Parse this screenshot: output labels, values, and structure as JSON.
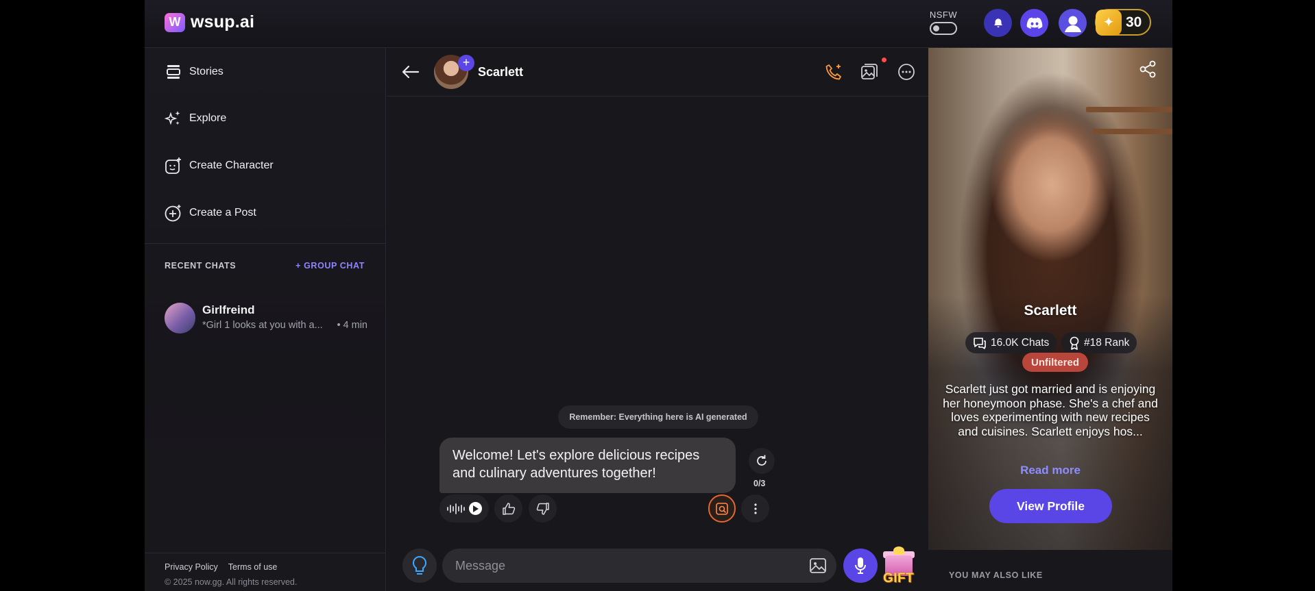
{
  "brand": {
    "logo_mark": "W",
    "name": "wsup.ai"
  },
  "topbar": {
    "nsfw_label": "NSFW",
    "nsfw_enabled": false,
    "coins": "30",
    "icons": [
      "bell-icon",
      "discord-icon",
      "user-icon",
      "star-icon"
    ]
  },
  "sidebar": {
    "nav": [
      {
        "label": "Stories",
        "icon": "stories-icon"
      },
      {
        "label": "Explore",
        "icon": "sparkles-icon"
      },
      {
        "label": "Create Character",
        "icon": "create-character-icon"
      },
      {
        "label": "Create a Post",
        "icon": "plus-circle-icon"
      }
    ],
    "recent_label": "RECENT CHATS",
    "group_chat": "+ GROUP CHAT",
    "recent": [
      {
        "name": "Girlfreind",
        "snippet": "*Girl 1 looks at you with a...",
        "time": "• 4 min"
      }
    ],
    "footer": {
      "privacy": "Privacy Policy",
      "terms": "Terms of use",
      "copyright": "© 2025 now.gg. All rights reserved."
    }
  },
  "chat": {
    "character_name": "Scarlett",
    "notice": "Remember: Everything here is AI generated",
    "message": "Welcome! Let's explore delicious recipes and culinary adventures together!",
    "regen_count": "0/3",
    "input_placeholder": "Message",
    "gift_label": "GIFT"
  },
  "profile": {
    "name": "Scarlett",
    "chats": "16.0K Chats",
    "rank": "#18 Rank",
    "tag": "Unfiltered",
    "description": "Scarlett just got married and is enjoying her honeymoon phase. She's a chef and loves experimenting with new recipes and cuisines. Scarlett enjoys hos...",
    "read_more": "Read more",
    "view_profile": "View Profile",
    "also_like": "YOU MAY ALSO LIKE"
  },
  "colors": {
    "accent": "#5a45e6",
    "gold": "#c9a02a",
    "unfiltered": "#b8463a",
    "link": "#8f8cff"
  }
}
